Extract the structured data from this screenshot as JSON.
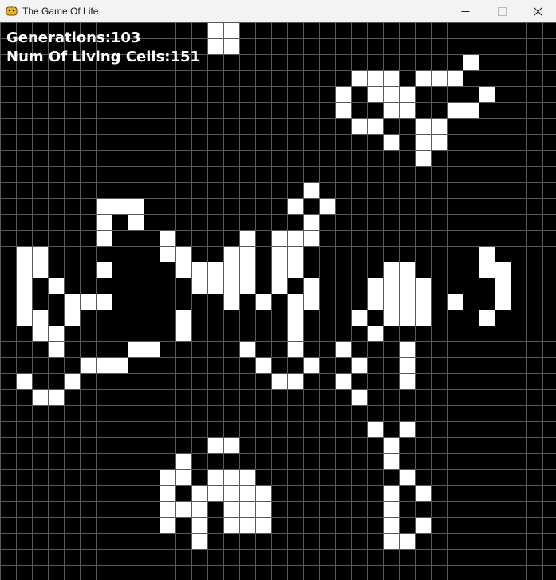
{
  "window": {
    "title": "The Game Of Life",
    "minimize_icon": "minimize-icon",
    "maximize_icon": "maximize-icon",
    "close_icon": "close-icon"
  },
  "hud": {
    "generations": "Generations:103",
    "living_cells": "Num Of Living Cells:151"
  },
  "grid": {
    "columns": 35,
    "rows": 35,
    "cell_color": "#ffffff",
    "background_color": "#000000",
    "grid_line_color": "#5a5a5a",
    "live_cells": [
      [
        13,
        0
      ],
      [
        14,
        0
      ],
      [
        13,
        1
      ],
      [
        14,
        1
      ],
      [
        29,
        2
      ],
      [
        22,
        3
      ],
      [
        23,
        3
      ],
      [
        24,
        3
      ],
      [
        26,
        3
      ],
      [
        27,
        3
      ],
      [
        28,
        3
      ],
      [
        21,
        4
      ],
      [
        23,
        4
      ],
      [
        24,
        4
      ],
      [
        25,
        4
      ],
      [
        30,
        4
      ],
      [
        21,
        5
      ],
      [
        24,
        5
      ],
      [
        25,
        5
      ],
      [
        28,
        5
      ],
      [
        29,
        5
      ],
      [
        22,
        6
      ],
      [
        23,
        6
      ],
      [
        26,
        6
      ],
      [
        27,
        6
      ],
      [
        24,
        7
      ],
      [
        26,
        7
      ],
      [
        27,
        7
      ],
      [
        26,
        8
      ],
      [
        19,
        10
      ],
      [
        18,
        11
      ],
      [
        20,
        11
      ],
      [
        6,
        11
      ],
      [
        7,
        11
      ],
      [
        8,
        11
      ],
      [
        6,
        12
      ],
      [
        8,
        12
      ],
      [
        19,
        12
      ],
      [
        6,
        13
      ],
      [
        17,
        13
      ],
      [
        18,
        13
      ],
      [
        19,
        13
      ],
      [
        10,
        13
      ],
      [
        15,
        13
      ],
      [
        1,
        14
      ],
      [
        2,
        14
      ],
      [
        10,
        14
      ],
      [
        11,
        14
      ],
      [
        14,
        14
      ],
      [
        15,
        14
      ],
      [
        17,
        14
      ],
      [
        18,
        14
      ],
      [
        30,
        14
      ],
      [
        1,
        15
      ],
      [
        2,
        15
      ],
      [
        6,
        15
      ],
      [
        11,
        15
      ],
      [
        12,
        15
      ],
      [
        13,
        15
      ],
      [
        14,
        15
      ],
      [
        15,
        15
      ],
      [
        17,
        15
      ],
      [
        18,
        15
      ],
      [
        24,
        15
      ],
      [
        25,
        15
      ],
      [
        30,
        15
      ],
      [
        31,
        15
      ],
      [
        1,
        16
      ],
      [
        3,
        16
      ],
      [
        12,
        16
      ],
      [
        13,
        16
      ],
      [
        14,
        16
      ],
      [
        15,
        16
      ],
      [
        17,
        16
      ],
      [
        19,
        16
      ],
      [
        23,
        16
      ],
      [
        24,
        16
      ],
      [
        25,
        16
      ],
      [
        26,
        16
      ],
      [
        31,
        16
      ],
      [
        1,
        17
      ],
      [
        4,
        17
      ],
      [
        5,
        17
      ],
      [
        6,
        17
      ],
      [
        14,
        17
      ],
      [
        16,
        17
      ],
      [
        18,
        17
      ],
      [
        19,
        17
      ],
      [
        23,
        17
      ],
      [
        24,
        17
      ],
      [
        25,
        17
      ],
      [
        26,
        17
      ],
      [
        28,
        17
      ],
      [
        31,
        17
      ],
      [
        1,
        18
      ],
      [
        2,
        18
      ],
      [
        4,
        18
      ],
      [
        11,
        18
      ],
      [
        18,
        18
      ],
      [
        22,
        18
      ],
      [
        24,
        18
      ],
      [
        25,
        18
      ],
      [
        26,
        18
      ],
      [
        30,
        18
      ],
      [
        2,
        19
      ],
      [
        3,
        19
      ],
      [
        11,
        19
      ],
      [
        18,
        19
      ],
      [
        23,
        19
      ],
      [
        3,
        20
      ],
      [
        8,
        20
      ],
      [
        9,
        20
      ],
      [
        15,
        20
      ],
      [
        18,
        20
      ],
      [
        21,
        20
      ],
      [
        25,
        20
      ],
      [
        5,
        21
      ],
      [
        6,
        21
      ],
      [
        7,
        21
      ],
      [
        16,
        21
      ],
      [
        19,
        21
      ],
      [
        22,
        21
      ],
      [
        25,
        21
      ],
      [
        1,
        22
      ],
      [
        4,
        22
      ],
      [
        17,
        22
      ],
      [
        18,
        22
      ],
      [
        21,
        22
      ],
      [
        25,
        22
      ],
      [
        2,
        23
      ],
      [
        3,
        23
      ],
      [
        22,
        23
      ],
      [
        23,
        25
      ],
      [
        25,
        25
      ],
      [
        13,
        26
      ],
      [
        14,
        26
      ],
      [
        24,
        26
      ],
      [
        11,
        27
      ],
      [
        24,
        27
      ],
      [
        10,
        28
      ],
      [
        11,
        28
      ],
      [
        13,
        28
      ],
      [
        14,
        28
      ],
      [
        15,
        28
      ],
      [
        25,
        28
      ],
      [
        10,
        29
      ],
      [
        12,
        29
      ],
      [
        13,
        29
      ],
      [
        14,
        29
      ],
      [
        15,
        29
      ],
      [
        16,
        29
      ],
      [
        24,
        29
      ],
      [
        26,
        29
      ],
      [
        10,
        30
      ],
      [
        11,
        30
      ],
      [
        12,
        30
      ],
      [
        14,
        30
      ],
      [
        15,
        30
      ],
      [
        16,
        30
      ],
      [
        24,
        30
      ],
      [
        10,
        31
      ],
      [
        12,
        31
      ],
      [
        14,
        31
      ],
      [
        15,
        31
      ],
      [
        16,
        31
      ],
      [
        24,
        31
      ],
      [
        26,
        31
      ],
      [
        12,
        32
      ],
      [
        24,
        32
      ],
      [
        25,
        32
      ]
    ]
  }
}
